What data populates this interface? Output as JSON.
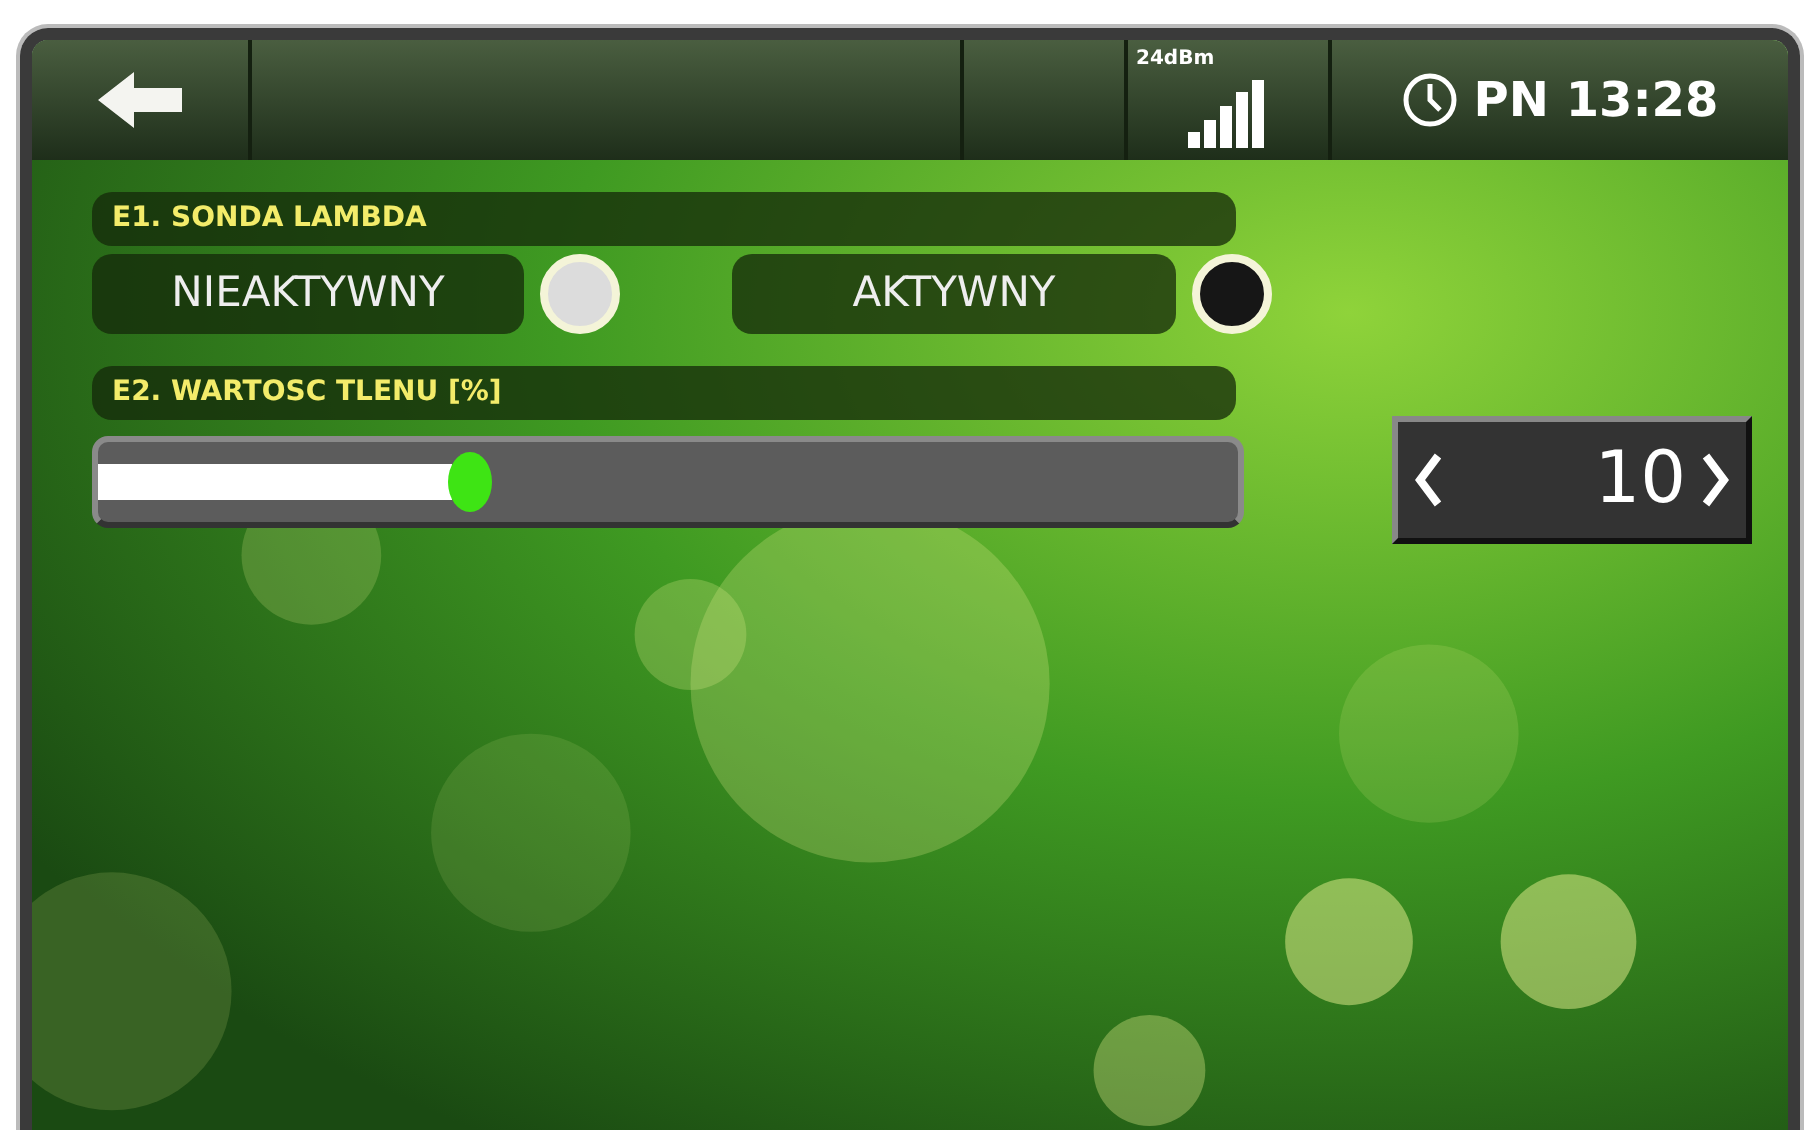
{
  "top_bar": {
    "signal_label": "24dBm",
    "day": "PN",
    "time": "13:28"
  },
  "sections": [
    {
      "title": "E1. SONDA LAMBDA",
      "kind": "radio",
      "options": [
        {
          "label": "NIEAKTYWNY",
          "selected": false
        },
        {
          "label": "AKTYWNY",
          "selected": true
        }
      ]
    },
    {
      "title": "E2. WARTOSC TLENU [%]",
      "kind": "slider",
      "level": 0.31,
      "value": "10"
    }
  ]
}
